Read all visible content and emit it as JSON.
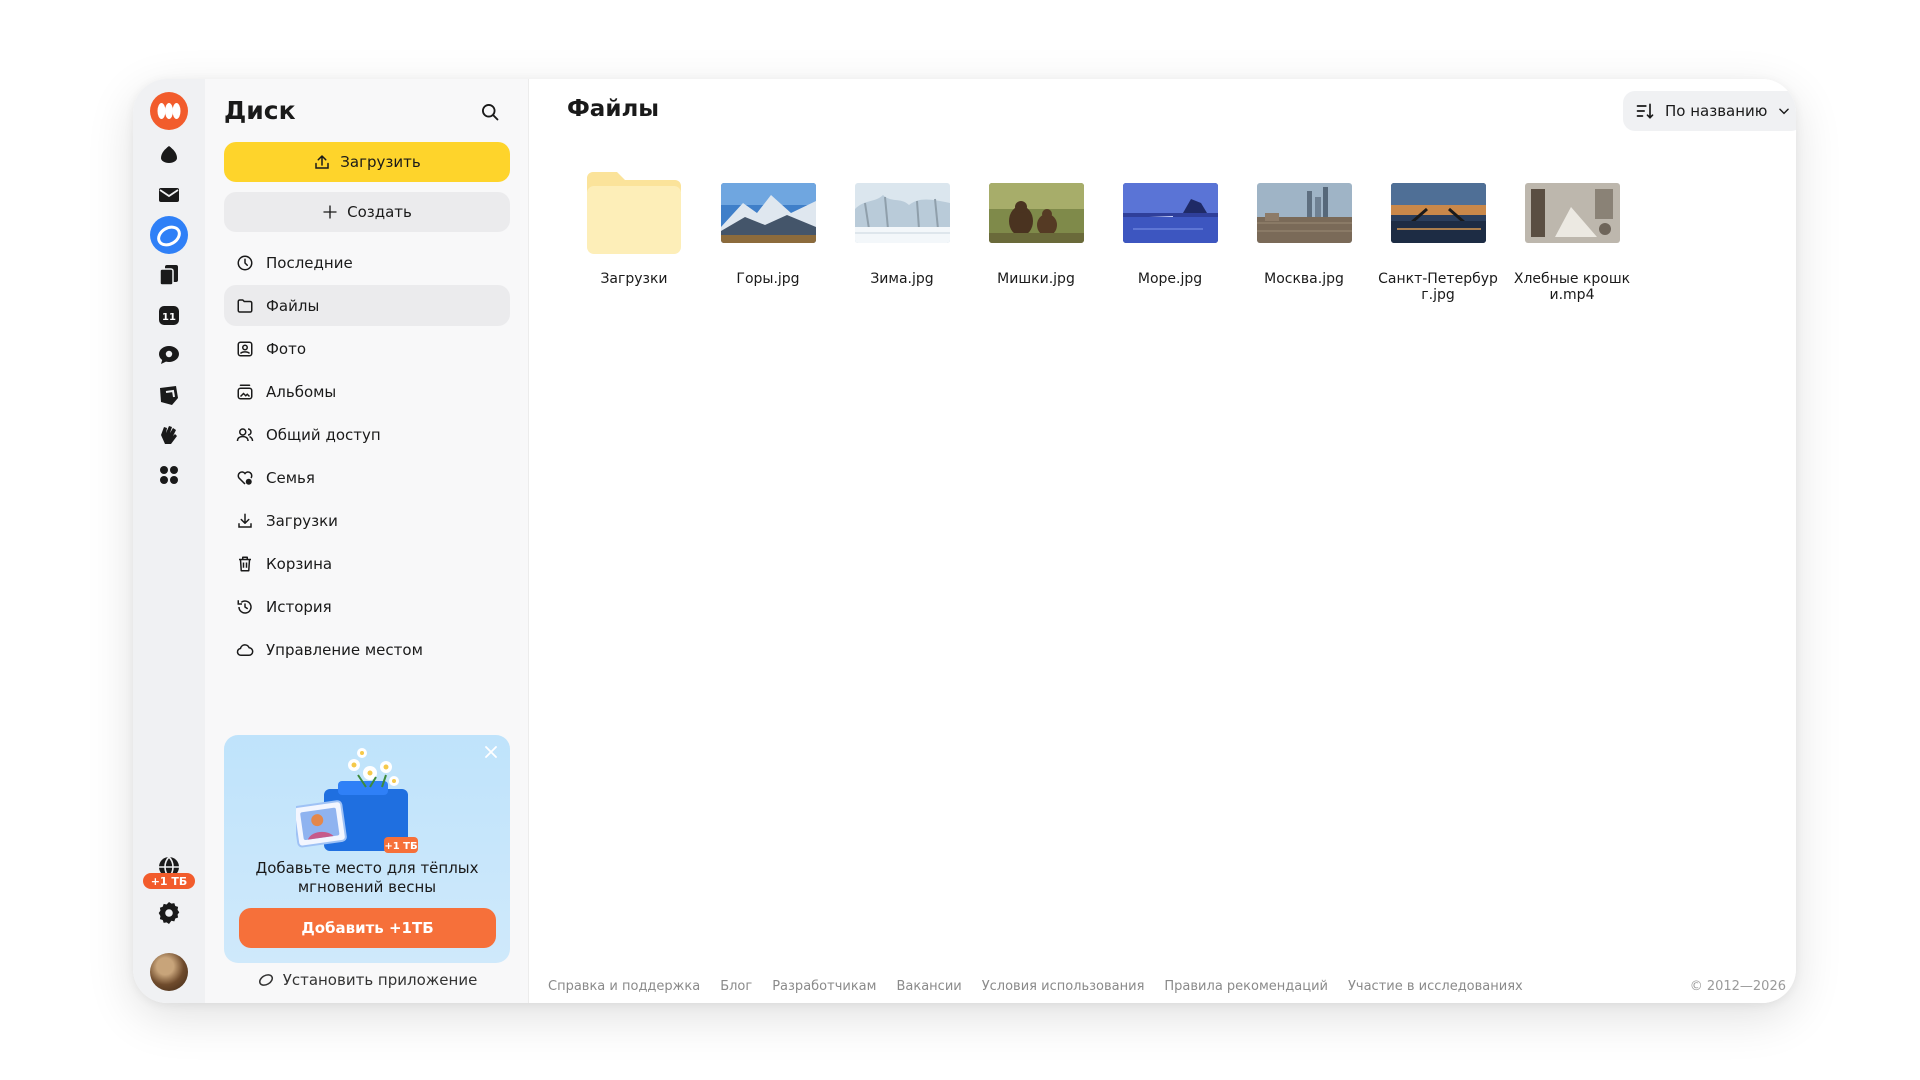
{
  "sidebar": {
    "app_title": "Диск",
    "upload_label": "Загрузить",
    "create_label": "Создать",
    "items": [
      {
        "label": "Последние",
        "icon": "clock-icon"
      },
      {
        "label": "Файлы",
        "icon": "folder-icon",
        "active": true
      },
      {
        "label": "Фото",
        "icon": "photo-icon"
      },
      {
        "label": "Альбомы",
        "icon": "album-icon"
      },
      {
        "label": "Общий доступ",
        "icon": "people-icon"
      },
      {
        "label": "Семья",
        "icon": "family-heart-icon"
      },
      {
        "label": "Загрузки",
        "icon": "download-icon"
      },
      {
        "label": "Корзина",
        "icon": "trash-icon"
      },
      {
        "label": "История",
        "icon": "history-icon"
      },
      {
        "label": "Управление местом",
        "icon": "cloud-icon"
      }
    ],
    "promo": {
      "badge": "+1 ТБ",
      "text": "Добавьте место для тёплых мгновений весны",
      "button": "Добавить +1ТБ"
    },
    "install_app": "Установить приложение"
  },
  "rail": {
    "icons": [
      "logo-icon",
      "cloud-icon",
      "mail-icon",
      "disk-icon",
      "docs-icon",
      "calendar-icon",
      "messenger-icon",
      "telemost-icon",
      "hand-icon",
      "apps-grid-icon",
      "gift-icon",
      "settings-icon"
    ],
    "badge": "+1 ТБ",
    "calendar_day": "11"
  },
  "main": {
    "title": "Файлы",
    "sort_label": "По названию",
    "files": [
      {
        "name": "Загрузки",
        "kind": "folder"
      },
      {
        "name": "Горы.jpg",
        "kind": "image"
      },
      {
        "name": "Зима.jpg",
        "kind": "image"
      },
      {
        "name": "Мишки.jpg",
        "kind": "image"
      },
      {
        "name": "Море.jpg",
        "kind": "image"
      },
      {
        "name": "Москва.jpg",
        "kind": "image"
      },
      {
        "name": "Санкт-Петербург.jpg",
        "kind": "image"
      },
      {
        "name": "Хлебные крошки.mp4",
        "kind": "video"
      }
    ]
  },
  "footer": {
    "links": [
      "Справка и поддержка",
      "Блог",
      "Разработчикам",
      "Вакансии",
      "Условия использования",
      "Правила рекомендаций",
      "Участие в исследованиях"
    ],
    "copyright": "© 2012—2026"
  },
  "colors": {
    "upload_button": "#fed42b",
    "promo_button": "#f6703a",
    "badge": "#f25c2c",
    "disk_accent": "#2f80f7"
  }
}
